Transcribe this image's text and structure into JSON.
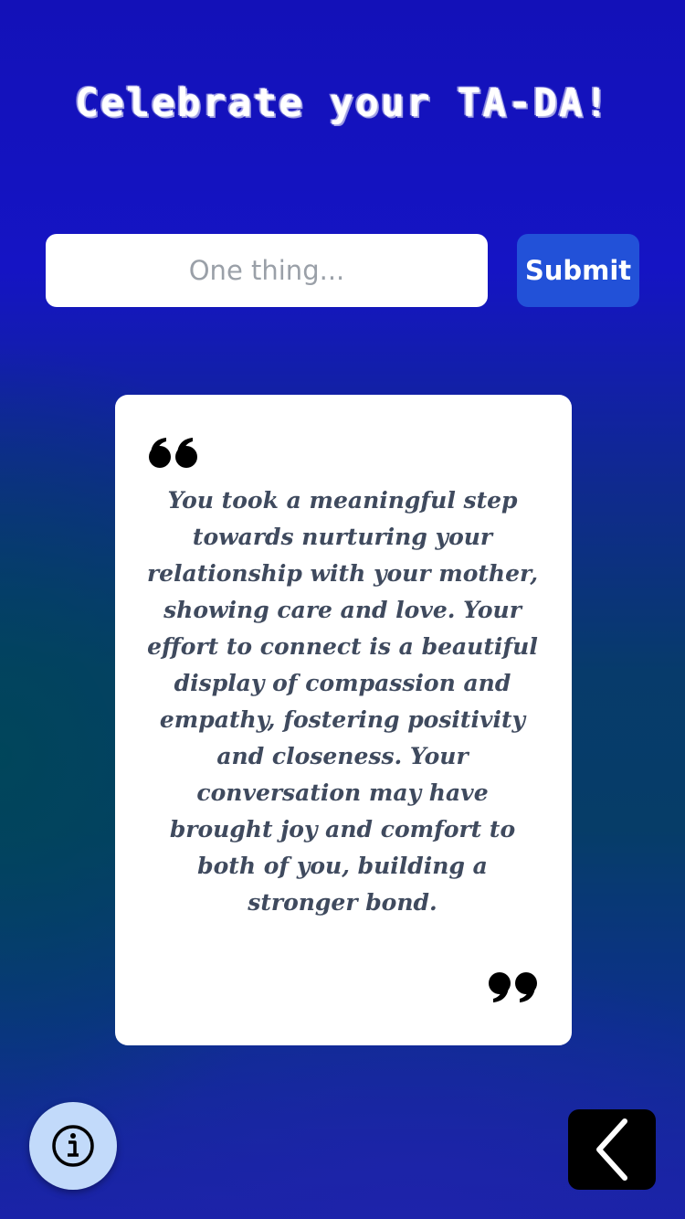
{
  "header": {
    "title": "Celebrate your TA-DA!"
  },
  "entry": {
    "placeholder": "One thing...",
    "value": "",
    "submit_label": "Submit"
  },
  "card": {
    "message": "You took a meaningful step towards nurturing your relationship with your mother, showing care and love. Your effort to connect is a beautiful display of compassion and empathy, fostering positivity and closeness. Your conversation may have brought joy and comfort to both of you, building a stronger bond.",
    "open_quote_icon": "open-quote-icon",
    "close_quote_icon": "close-quote-icon"
  },
  "footer": {
    "info_icon": "info-icon",
    "back_icon": "chevron-left-icon"
  },
  "colors": {
    "submit_button": "#2251d8",
    "info_button": "#c2dafa",
    "back_button": "#000000",
    "message_text": "#3f4a5e",
    "background_top": "#1311b8",
    "background_middle": "#063d68"
  }
}
